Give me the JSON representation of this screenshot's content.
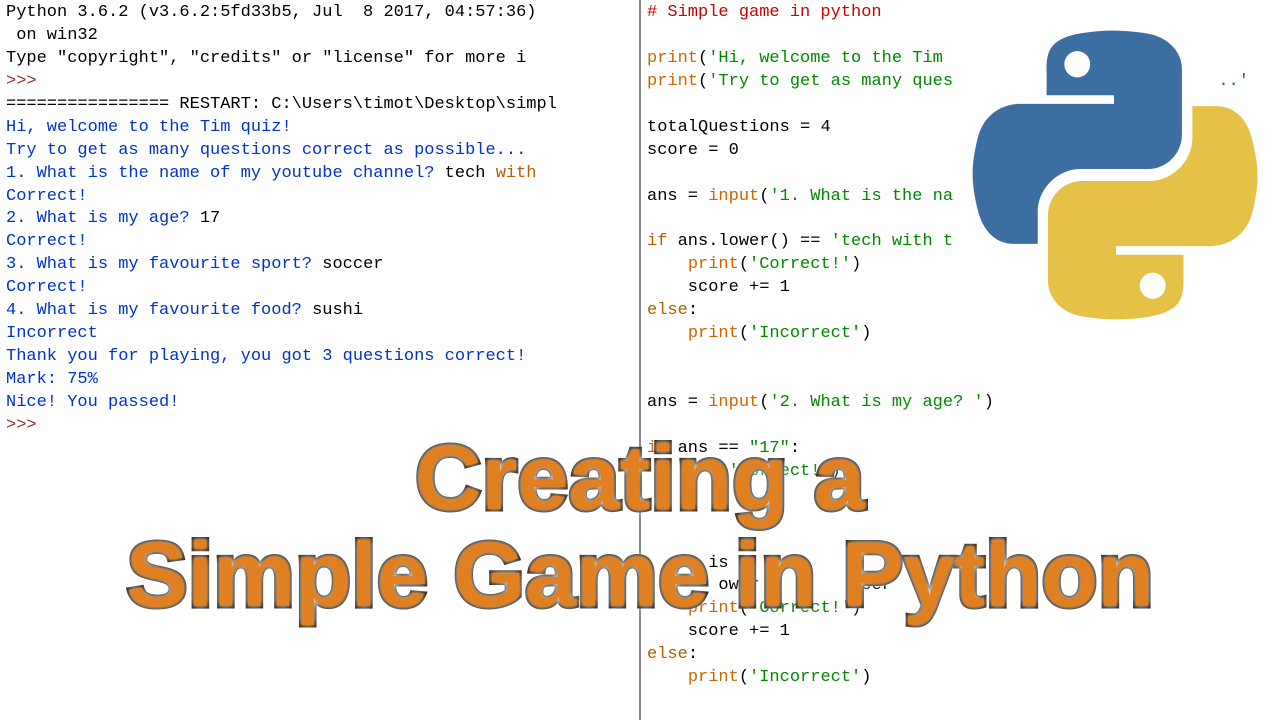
{
  "shell": {
    "header1": "Python 3.6.2 (v3.6.2:5fd33b5, Jul  8 2017, 04:57:36) ",
    "header2": " on win32",
    "header3": "Type \"copyright\", \"credits\" or \"license\" for more i",
    "prompt1": ">>> ",
    "restart": "================ RESTART: C:\\Users\\timot\\Desktop\\simpl",
    "welcome": "Hi, welcome to the Tim quiz!",
    "try": "Try to get as many questions correct as possible...",
    "q1": "1. What is the name of my youtube channel? ",
    "a1a": "tech ",
    "a1b": "with",
    "correct1": "Correct!",
    "q2": "2. What is my age? ",
    "a2": "17",
    "correct2": "Correct!",
    "q3": "3. What is my favourite sport? ",
    "a3": "soccer",
    "correct3": "Correct!",
    "q4": "4. What is my favourite food? ",
    "a4": "sushi",
    "incorrect": "Incorrect",
    "thanks": "Thank you for playing, you got 3 questions correct!",
    "mark": "Mark: 75%",
    "passed": "Nice! You passed!",
    "prompt2": ">>> "
  },
  "editor": {
    "comment": "# Simple game in python",
    "blank": "",
    "print1a": "print",
    "print1b": "(",
    "print1c": "'Hi, welcome to the Tim",
    "print2c": "'Try to get as many ques",
    "print2d": "..'",
    "totalQ": "totalQuestions = ",
    "totalQv": "4",
    "score": "score = ",
    "scorev": "0",
    "ans1a": "ans = ",
    "input": "input",
    "ans1c": "(",
    "ans1d": "'1. What is the na",
    "ans1e": "')",
    "if1": "if",
    "if1b": " ans.lower() == ",
    "if1c": "'tech with t",
    "correct": "'Correct!'",
    "scoreinc": "    score += ",
    "one": "1",
    "else": "else",
    "colon": ":",
    "incorrectS": "'Incorrect'",
    "ans2d": "'2. What is my age? '",
    "if2b": " ans == ",
    "if2c": "\"17\"",
    "frag1": "is m",
    "frag2": "ower",
    "frag3": "cer",
    "printopen": "(",
    "printclose": ")",
    "indent": "    "
  },
  "overlay": {
    "line1": "Creating a",
    "line2": "Simple Game in Python"
  }
}
